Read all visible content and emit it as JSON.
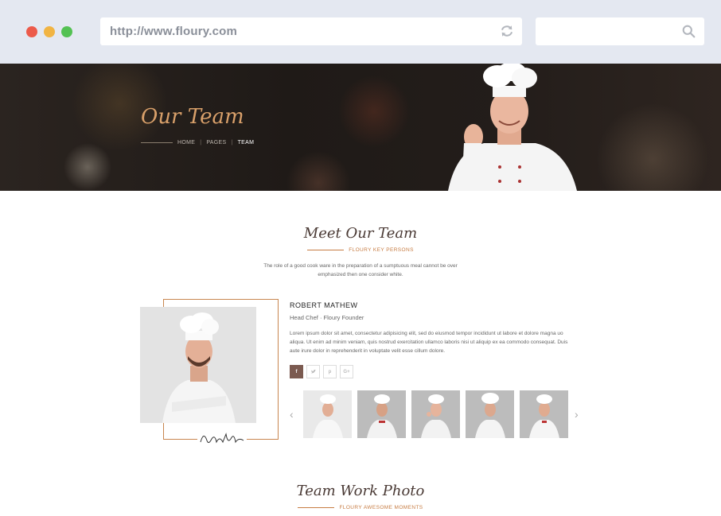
{
  "browser": {
    "url": "http://www.floury.com",
    "search_placeholder": ""
  },
  "hero": {
    "title": "Our Team",
    "breadcrumb": [
      "HOME",
      "PAGES",
      "TEAM"
    ]
  },
  "meet": {
    "title": "Meet Our Team",
    "subtitle": "FLOURY KEY PERSONS",
    "intro": "The role of a good cook ware in the preparation of a sumptuous meal cannot be over emphasized then one consider white."
  },
  "member": {
    "name": "ROBERT MATHEW",
    "role": "Head Chef · Floury Founder",
    "bio": "Lorem ipsum dolor sit amet, consectetur adipisicing elit, sed do eiusmod tempor incididunt ut labore et dolore magna uo aliqua. Ut enim ad minim veniam, quis nostrud exercitation ullamco laboris nisi ut aliquip ex ea commodo consequat. Duis aute irure dolor in reprehenderit in voluptate velit esse cillum dolore.",
    "signature": "Robert Mathew",
    "socials": [
      "f",
      "t",
      "p",
      "G+"
    ]
  },
  "gallery": {
    "title": "Team Work Photo",
    "subtitle": "FLOURY AWESOME MOMENTS"
  },
  "colors": {
    "accent": "#c77c43",
    "hero_title": "#d9a06a",
    "social_active": "#7b5a50"
  }
}
